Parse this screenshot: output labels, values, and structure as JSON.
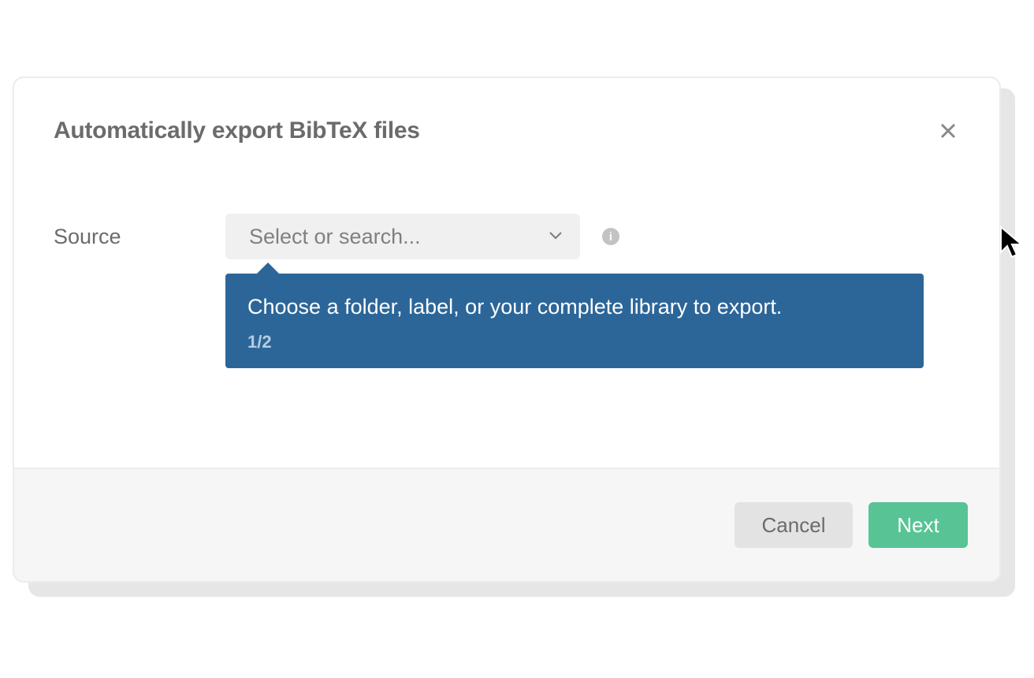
{
  "modal": {
    "title": "Automatically export BibTeX files",
    "close_icon": "close-icon"
  },
  "form": {
    "source_label": "Source",
    "source_placeholder": "Select or search...",
    "info_glyph": "i"
  },
  "tooltip": {
    "text": "Choose a folder, label, or your complete library to export.",
    "step": "1/2"
  },
  "footer": {
    "cancel_label": "Cancel",
    "next_label": "Next"
  },
  "colors": {
    "tooltip_bg": "#2c6699",
    "next_btn": "#58c495"
  }
}
